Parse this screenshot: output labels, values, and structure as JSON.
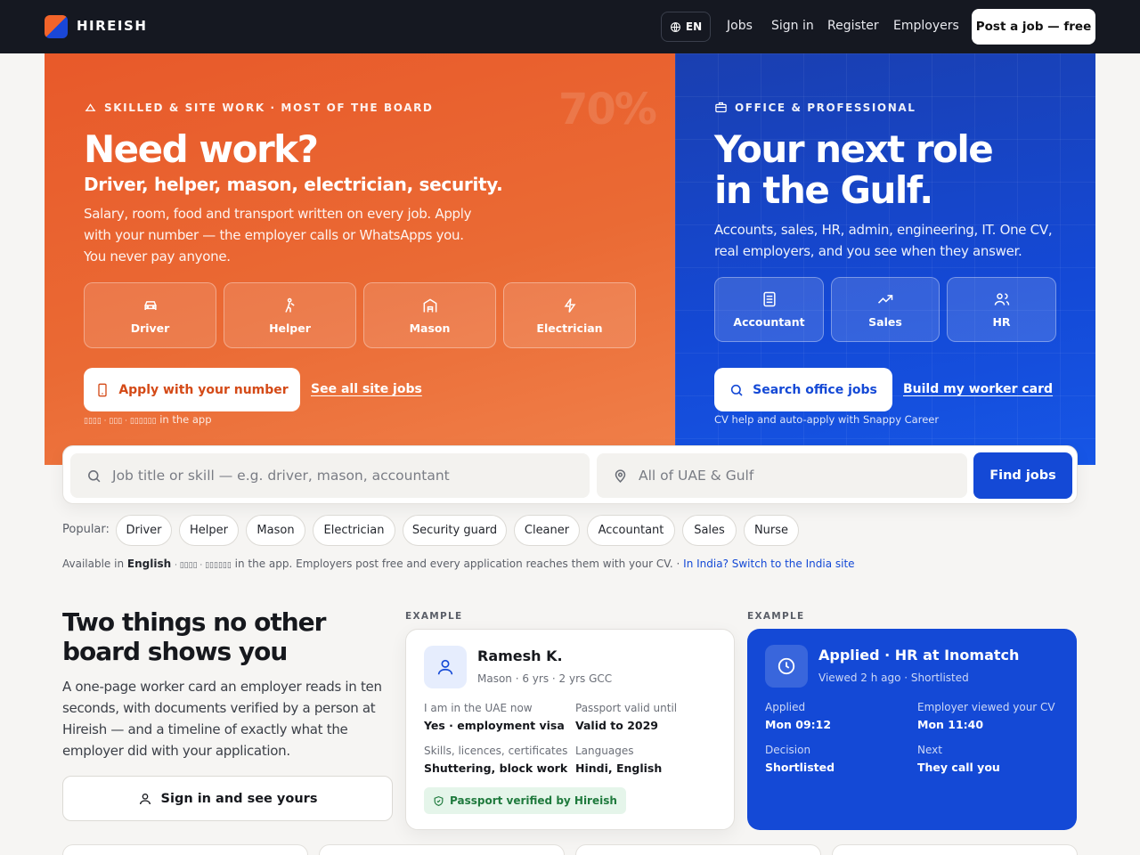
{
  "brand": {
    "name": "HIREISH"
  },
  "nav": {
    "lang": "EN",
    "links": [
      "Jobs",
      "Sign in",
      "Register",
      "Employers"
    ],
    "post_job": "Post a job — free"
  },
  "hero_left": {
    "eyebrow": "SKILLED & SITE WORK · MOST OF THE BOARD",
    "stat": "70%",
    "title": "Need work?",
    "subtitle": "Driver, helper, mason, electrician, security.",
    "body": "Salary, room, food and transport written on every job. Apply with your number — the employer calls or WhatsApps you. You never pay anyone.",
    "tiles": [
      {
        "label": "Driver",
        "icon": "car-icon"
      },
      {
        "label": "Helper",
        "icon": "person-helper-icon"
      },
      {
        "label": "Mason",
        "icon": "building-icon"
      },
      {
        "label": "Electrician",
        "icon": "bolt-icon"
      }
    ],
    "cta": "Apply with your number",
    "link": "See all site jobs",
    "hint_glyphs": "▯▯▯▯ · ▯▯▯ · ▯▯▯▯▯▯",
    "hint_text": "in the app"
  },
  "hero_right": {
    "eyebrow": "OFFICE & PROFESSIONAL",
    "title_line1": "Your next role",
    "title_line2": "in the Gulf.",
    "body": "Accounts, sales, HR, admin, engineering, IT. One CV, real employers, and you see when they answer.",
    "tiles": [
      {
        "label": "Accountant",
        "icon": "document-icon"
      },
      {
        "label": "Sales",
        "icon": "trend-up-icon"
      },
      {
        "label": "HR",
        "icon": "users-icon"
      }
    ],
    "cta": "Search office jobs",
    "link": "Build my worker card",
    "hint": "CV help and auto-apply with Snappy Career"
  },
  "search": {
    "job_placeholder": "Job title or skill — e.g. driver, mason, accountant",
    "location_placeholder": "All of UAE & Gulf",
    "button": "Find jobs"
  },
  "popular": {
    "label": "Popular:",
    "chips": [
      "Driver",
      "Helper",
      "Mason",
      "Electrician",
      "Security guard",
      "Cleaner",
      "Accountant",
      "Sales",
      "Nurse"
    ]
  },
  "availability": {
    "prefix": "Available in",
    "lang": "English",
    "glyphs": "· ▯▯▯▯ · ▯▯▯▯▯▯",
    "text": "in the app. Employers post free and every application reaches them with your CV. ·",
    "switch": "In India? Switch to the India site"
  },
  "features": {
    "title_line1": "Two things no other",
    "title_line2": "board shows you",
    "body": "A one-page worker card an employer reads in ten seconds, with documents verified by a person at Hireish — and a timeline of exactly what the employer did with your application.",
    "button": "Sign in and see yours"
  },
  "worker_card": {
    "label": "EXAMPLE",
    "name": "Ramesh K.",
    "meta": "Mason · 6 yrs · 2 yrs GCC",
    "fields": [
      {
        "k": "I am in the UAE now",
        "v": "Yes · employment visa"
      },
      {
        "k": "Passport valid until",
        "v": "Valid to 2029"
      },
      {
        "k": "Skills, licences, certificates",
        "v": "Shuttering, block work"
      },
      {
        "k": "Languages",
        "v": "Hindi, English"
      }
    ],
    "verified": "Passport verified by Hireish"
  },
  "timeline_card": {
    "label": "EXAMPLE",
    "title": "Applied · HR at Inomatch",
    "meta": "Viewed 2 h ago · Shortlisted",
    "fields": [
      {
        "k": "Applied",
        "v": "Mon 09:12"
      },
      {
        "k": "Employer viewed your CV",
        "v": "Mon 11:40"
      },
      {
        "k": "Decision",
        "v": "Shortlisted"
      },
      {
        "k": "Next",
        "v": "They call you"
      }
    ]
  },
  "colors": {
    "orange": "#e8592a",
    "blue": "#1449d6",
    "nav": "#151821"
  }
}
